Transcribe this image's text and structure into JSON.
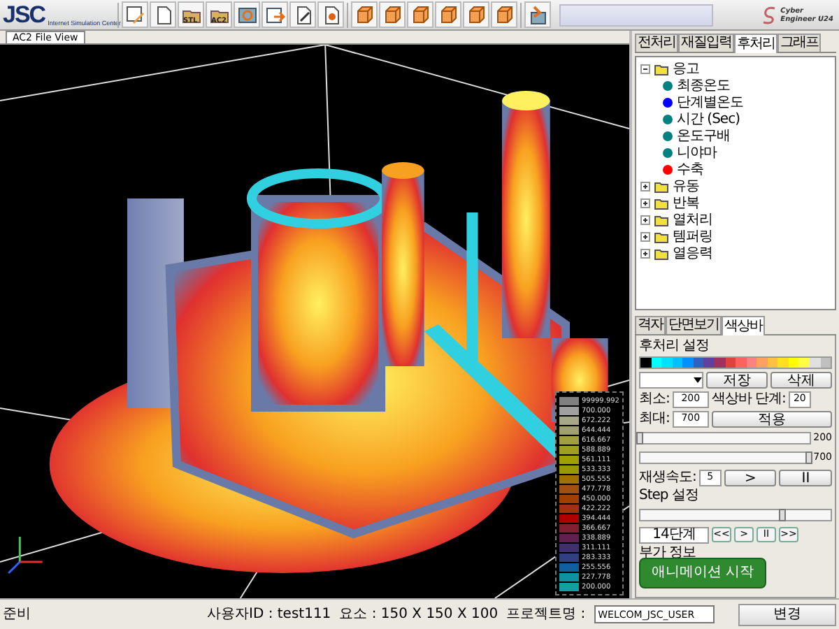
{
  "header": {
    "logo": "JSC",
    "logo_subtitle": "Internet Simulation Center",
    "brand_top": "Cyber",
    "brand_bottom": "Engineer U24"
  },
  "toolbar": [
    {
      "kind": "edit"
    },
    {
      "kind": "page"
    },
    {
      "kind": "folder",
      "badge": "STL"
    },
    {
      "kind": "folder",
      "badge": "AC2"
    },
    {
      "kind": "refresh"
    },
    {
      "kind": "export"
    },
    {
      "kind": "pen"
    },
    {
      "kind": "record"
    },
    {
      "kind": "cube"
    },
    {
      "kind": "cube"
    },
    {
      "kind": "cube"
    },
    {
      "kind": "cube"
    },
    {
      "kind": "cube"
    },
    {
      "kind": "cube"
    },
    {
      "kind": "import"
    }
  ],
  "viewport": {
    "tab": "AC2 File View",
    "legend": [
      {
        "label": "99999.992",
        "color": "#808080"
      },
      {
        "label": "700.000",
        "color": "#a0a0a0"
      },
      {
        "label": "672.222",
        "color": "#a8a888"
      },
      {
        "label": "644.444",
        "color": "#a0a070"
      },
      {
        "label": "616.667",
        "color": "#a0a040"
      },
      {
        "label": "588.889",
        "color": "#a0a020"
      },
      {
        "label": "561.111",
        "color": "#a0a000"
      },
      {
        "label": "533.333",
        "color": "#989800"
      },
      {
        "label": "505.555",
        "color": "#a07000"
      },
      {
        "label": "477.778",
        "color": "#a05010"
      },
      {
        "label": "450.000",
        "color": "#a04000"
      },
      {
        "label": "422.222",
        "color": "#a03010"
      },
      {
        "label": "394.444",
        "color": "#b00000"
      },
      {
        "label": "366.667",
        "color": "#802030"
      },
      {
        "label": "338.889",
        "color": "#602050"
      },
      {
        "label": "311.111",
        "color": "#403070"
      },
      {
        "label": "283.333",
        "color": "#304080"
      },
      {
        "label": "255.556",
        "color": "#1060a0"
      },
      {
        "label": "227.778",
        "color": "#1090a0"
      },
      {
        "label": "200.000",
        "color": "#10a0a0"
      }
    ]
  },
  "right_panel": {
    "tabs": [
      {
        "label": "전처리",
        "selected": false
      },
      {
        "label": "재질입력",
        "selected": false
      },
      {
        "label": "후처리",
        "selected": true
      },
      {
        "label": "그래프",
        "selected": false
      }
    ],
    "tree": [
      {
        "label": "응고",
        "expanded": true,
        "children": [
          {
            "label": "최종온도",
            "color": "#008080"
          },
          {
            "label": "단계별온도",
            "color": "#0000ff"
          },
          {
            "label": "시간 (Sec)",
            "color": "#008080"
          },
          {
            "label": "온도구배",
            "color": "#008080"
          },
          {
            "label": "니야마",
            "color": "#008080"
          },
          {
            "label": "수축",
            "color": "#ff0000"
          }
        ]
      },
      {
        "label": "유동",
        "expanded": false
      },
      {
        "label": "반복",
        "expanded": false
      },
      {
        "label": "열처리",
        "expanded": false
      },
      {
        "label": "템퍼링",
        "expanded": false
      },
      {
        "label": "열응력",
        "expanded": false
      }
    ],
    "bottom_tabs": [
      {
        "label": "격자",
        "selected": false
      },
      {
        "label": "단면보기",
        "selected": false
      },
      {
        "label": "색상바",
        "selected": true
      }
    ],
    "colorbar": {
      "title": "후처리 설정",
      "palette": [
        {
          "color": "#000000"
        },
        {
          "color": "#00ffff"
        },
        {
          "color": "#00e0ff"
        },
        {
          "color": "#00c0ff"
        },
        {
          "color": "#0090ff"
        },
        {
          "color": "#3060c0"
        },
        {
          "color": "#6040a0"
        },
        {
          "color": "#a03060"
        },
        {
          "color": "#e04040"
        },
        {
          "color": "#ff6060"
        },
        {
          "color": "#ff8080"
        },
        {
          "color": "#ffa060"
        },
        {
          "color": "#ffc040"
        },
        {
          "color": "#ffe020"
        },
        {
          "color": "#ffff00"
        },
        {
          "color": "#ffff40"
        },
        {
          "color": "#e0e0e0"
        },
        {
          "color": "#c0c0c0"
        }
      ],
      "save": "저장",
      "delete": "삭제",
      "min_label": "최소:",
      "min_value": "200",
      "steps_label": "색상바 단계:",
      "steps_value": "20",
      "max_label": "최대:",
      "max_value": "700",
      "apply": "적용",
      "min_slider": {
        "level": 0,
        "reading": "200"
      },
      "max_slider": {
        "level": 1,
        "reading": "700"
      },
      "speed_label": "재생속도:",
      "speed_value": "5",
      "play": ">",
      "pause": "II",
      "step_label": "Step 설정",
      "step_slider": {
        "level": 0.75
      },
      "step_reading": "14단계",
      "nav": [
        "<<",
        ">",
        "II",
        ">>"
      ],
      "extra_label": "부가 정보",
      "tooltip": "애니메이션 시작"
    }
  },
  "status_bar": {
    "status": "준비",
    "user": "사용자ID : test111",
    "elements": "요소 : 150 X 150 X 100",
    "project_label": "프로젝트명 :",
    "project_value": "WELCOM_JSC_USER",
    "change": "변경"
  }
}
